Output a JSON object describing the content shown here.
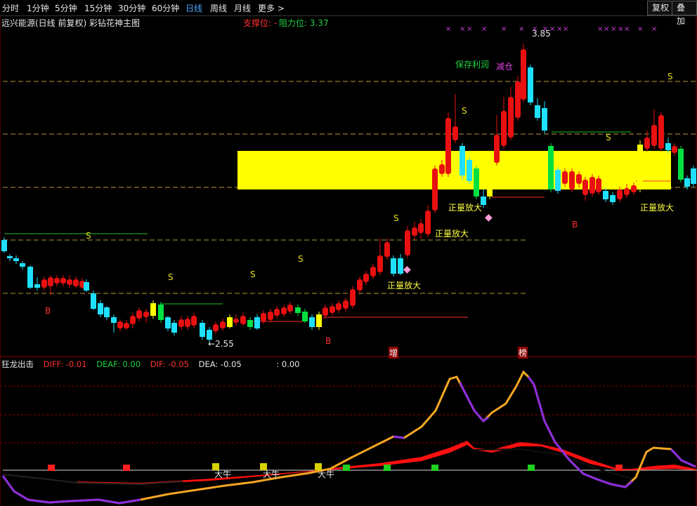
{
  "toolbar": {
    "periods": [
      "分时",
      "1分钟",
      "5分钟",
      "15分钟",
      "30分钟",
      "60分钟",
      "日线",
      "周线",
      "月线",
      "更多 >"
    ],
    "active_period": "日线",
    "fuquan_label": "复权",
    "diejia_label": "叠加"
  },
  "main_chart": {
    "title": "远兴能源(日线 前复权) 彩钻花神主图",
    "support_label": "支撑位: -",
    "resistance_label": "阻力位: 3.37",
    "high_price_label": "3.85",
    "low_price_label": "←2.55",
    "annotations": {
      "save_profit": "保存利润",
      "reduce_position": "减仓",
      "volume_up": "正量放大",
      "sell_mark": "S",
      "buy_mark": "B",
      "zeng_mark": "增",
      "bang_mark": "榜"
    }
  },
  "indicator": {
    "name": "狂龙出击",
    "diff": "DIFF: -0.01",
    "deaf": "DEAF: 0.00",
    "dif": "DIF: -0.05",
    "dea": "DEA: -0.05",
    "extra": ": 0.00",
    "daniu_label": "大牛"
  },
  "colors": {
    "up": "#e81010",
    "down": "#20e0ff",
    "grid_dash": "#b89a3c",
    "yellow_band": "#ffff00",
    "orange_line": "#f5a623",
    "purple_line": "#8a2be2",
    "red_fill": "#ff1010",
    "green_signal": "#00d020"
  }
}
